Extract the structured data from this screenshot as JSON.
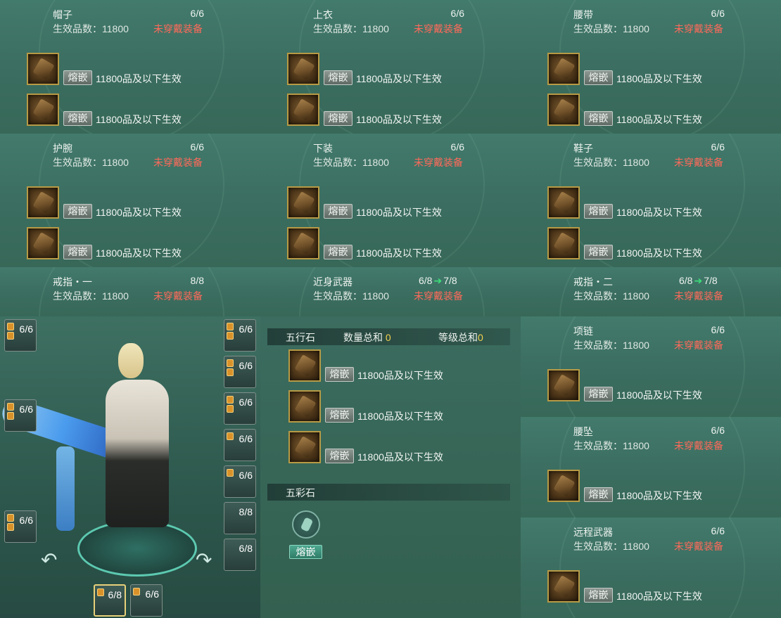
{
  "common": {
    "effective_label": "生效品数：11800",
    "not_worn": "未穿戴装备",
    "embed_label": "熔嵌",
    "slot_text": "11800品及以下生效",
    "arrow": "➔"
  },
  "panels": [
    {
      "name": "帽子",
      "count": "6/6"
    },
    {
      "name": "上衣",
      "count": "6/6"
    },
    {
      "name": "腰带",
      "count": "6/6"
    },
    {
      "name": "护腕",
      "count": "6/6"
    },
    {
      "name": "下装",
      "count": "6/6"
    },
    {
      "name": "鞋子",
      "count": "6/6"
    },
    {
      "name": "戒指・一",
      "count": "8/8"
    },
    {
      "name": "近身武器",
      "count_from": "6/8",
      "count_to": "7/8"
    },
    {
      "name": "戒指・二",
      "count_from": "6/8",
      "count_to": "7/8"
    }
  ],
  "right_list": [
    {
      "name": "项链",
      "count": "6/6"
    },
    {
      "name": "腰坠",
      "count": "6/6"
    },
    {
      "name": "远程武器",
      "count": "6/6"
    }
  ],
  "five_elements": {
    "label": "五行石",
    "qty_label": "数量总和",
    "qty_value": "0",
    "lvl_label": "等级总和",
    "lvl_value": "0"
  },
  "five_color": {
    "label": "五彩石",
    "button": "熔嵌"
  },
  "equip_slots": {
    "left": [
      "6/6",
      "6/6",
      "6/6"
    ],
    "right": [
      "6/6",
      "6/6",
      "6/6",
      "6/6",
      "6/6",
      "8/8",
      "6/8"
    ],
    "bottom": [
      "6/8",
      "6/6"
    ]
  }
}
